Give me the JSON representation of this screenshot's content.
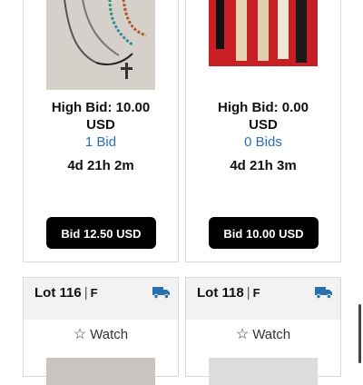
{
  "listings": [
    {
      "high_bid": "High Bid: 10.00",
      "currency": "USD",
      "bids_count": "1 Bid",
      "time_left": "4d 21h 2m",
      "bid_button": "Bid 12.50 USD"
    },
    {
      "high_bid": "High Bid: 0.00",
      "currency": "USD",
      "bids_count": "0 Bids",
      "time_left": "4d 21h 3m",
      "bid_button": "Bid 10.00 USD"
    }
  ],
  "lots": [
    {
      "lot": "Lot 116",
      "separator": "|",
      "flag": "F",
      "watch": "Watch"
    },
    {
      "lot": "Lot 118",
      "separator": "|",
      "flag": "F",
      "watch": "Watch"
    }
  ],
  "colors": {
    "link": "#2a6fb0",
    "truck": "#2a6fb0",
    "button": "#000000"
  },
  "icons": {
    "shipping": "truck-icon",
    "watch": "star-icon"
  }
}
